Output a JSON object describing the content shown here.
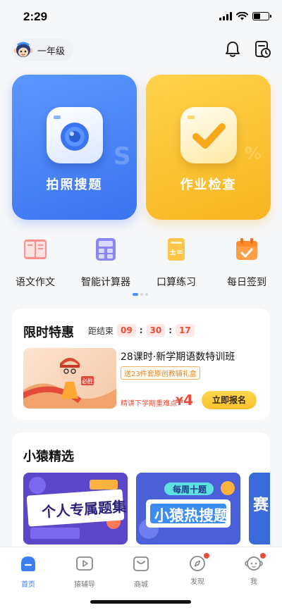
{
  "status_bar": {
    "time": "2:29"
  },
  "header": {
    "grade": "一年级"
  },
  "cards": [
    {
      "label": "拍照搜题",
      "icon": "camera-icon"
    },
    {
      "label": "作业检查",
      "icon": "check-icon"
    }
  ],
  "tools": [
    {
      "label": "语文作文",
      "icon": "book-icon"
    },
    {
      "label": "智能计算器",
      "icon": "calculator-icon"
    },
    {
      "label": "口算练习",
      "icon": "arithmetic-doc-icon"
    },
    {
      "label": "每日签到",
      "icon": "calendar-check-icon"
    }
  ],
  "sale": {
    "title": "限时特惠",
    "countdown_label": "距结束",
    "hours": "09",
    "minutes": "30",
    "seconds": "17",
    "separator": ":",
    "course_name": "28课时·新学期语数特训班",
    "gift": "送23件套原创教辅礼盒",
    "sub": "精讲下学期重难点",
    "price_symbol": "¥",
    "price": "4",
    "button": "立即报名",
    "img_tag": "必胜"
  },
  "picks": {
    "title": "小猿精选",
    "items": [
      {
        "label": "个人专属题集"
      },
      {
        "label": "小猿热搜题",
        "sub": "每周十题"
      },
      {
        "label": "赛"
      }
    ]
  },
  "tabbar": [
    {
      "label": "首页",
      "active": true
    },
    {
      "label": "猿辅导",
      "active": false
    },
    {
      "label": "商城",
      "active": false
    },
    {
      "label": "发现",
      "active": false
    },
    {
      "label": "我",
      "active": false
    }
  ],
  "colors": {
    "accent_blue": "#3b74f0",
    "accent_yellow": "#f7b521",
    "price_red": "#ec4b37"
  }
}
